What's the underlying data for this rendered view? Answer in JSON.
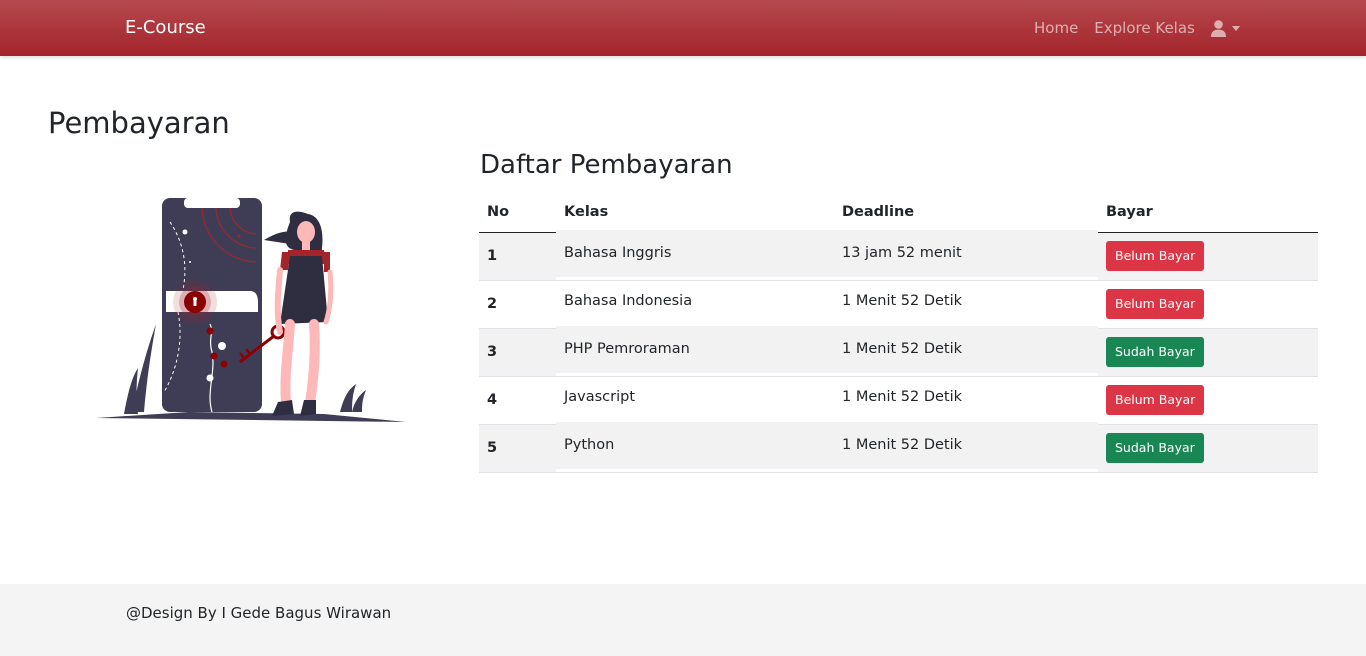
{
  "navbar": {
    "brand": "E-Course",
    "links": [
      {
        "label": "Home"
      },
      {
        "label": "Explore Kelas"
      }
    ],
    "user_icon": "user-icon"
  },
  "page": {
    "title": "Pembayaran",
    "illustration": "woman-with-key-and-phone-lock-illustration"
  },
  "payments": {
    "title": "Daftar Pembayaran",
    "columns": [
      "No",
      "Kelas",
      "Deadline",
      "Bayar"
    ],
    "rows": [
      {
        "no": "1",
        "kelas": "Bahasa Inggris",
        "deadline": "13 jam 52 menit",
        "status": "Belum Bayar",
        "status_color": "#dc3545"
      },
      {
        "no": "2",
        "kelas": "Bahasa Indonesia",
        "deadline": "1 Menit 52 Detik",
        "status": "Belum Bayar",
        "status_color": "#dc3545"
      },
      {
        "no": "3",
        "kelas": "PHP Pemroraman",
        "deadline": "1 Menit 52 Detik",
        "status": "Sudah Bayar",
        "status_color": "#198754"
      },
      {
        "no": "4",
        "kelas": "Javascript",
        "deadline": "1 Menit 52 Detik",
        "status": "Belum Bayar",
        "status_color": "#dc3545"
      },
      {
        "no": "5",
        "kelas": "Python",
        "deadline": "1 Menit 52 Detik",
        "status": "Sudah Bayar",
        "status_color": "#198754"
      }
    ]
  },
  "footer": {
    "text": "@Design By I Gede Bagus Wirawan"
  },
  "colors": {
    "navbar": "#a3242a",
    "danger": "#dc3545",
    "success": "#198754"
  }
}
